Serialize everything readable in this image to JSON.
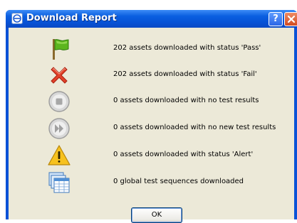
{
  "window": {
    "title": "Download Report",
    "help_label": "?",
    "app_icon": "app-logo-icon",
    "title_gradient_color": "#0a5fe0",
    "client_bg": "#ece9d8"
  },
  "rows": [
    {
      "icon": "green-flag-icon",
      "label": "202 assets downloaded with status 'Pass'"
    },
    {
      "icon": "red-x-icon",
      "label": "202 assets downloaded with status 'Fail'"
    },
    {
      "icon": "stop-circle-icon",
      "label": "0 assets downloaded with no test results"
    },
    {
      "icon": "fast-forward-circle-icon",
      "label": "0 assets downloaded with no new test results"
    },
    {
      "icon": "warning-triangle-icon",
      "label": "0 assets downloaded with status 'Alert'"
    },
    {
      "icon": "test-sequences-icon",
      "label": "0 global test sequences downloaded"
    }
  ],
  "ok_button": {
    "label": "OK"
  }
}
